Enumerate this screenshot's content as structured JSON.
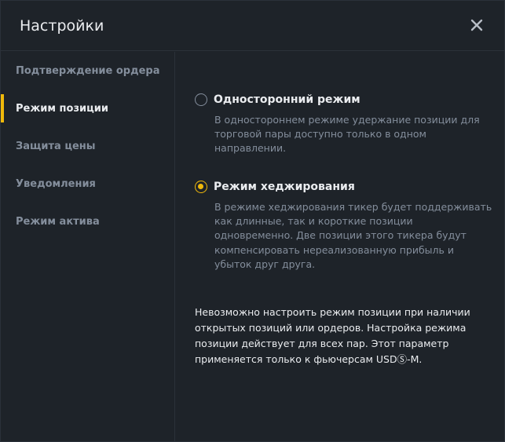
{
  "dialog": {
    "title": "Настройки"
  },
  "sidebar": {
    "items": [
      {
        "label": "Подтверждение ордера"
      },
      {
        "label": "Режим позиции"
      },
      {
        "label": "Защита цены"
      },
      {
        "label": "Уведомления"
      },
      {
        "label": "Режим актива"
      }
    ],
    "active": "Режим позиции"
  },
  "position_mode": {
    "options": [
      {
        "label": "Односторонний режим",
        "description": "В одностороннем режиме удержание позиции для торговой пары доступно только в одном направлении.",
        "selected": false
      },
      {
        "label": "Режим хеджирования",
        "description": "В режиме хеджирования тикер будет поддерживать как длинные, так и короткие позиции одновременно. Две позиции этого тикера будут компенсировать нереализованную прибыль и убыток друг друга.",
        "selected": true
      }
    ],
    "note": "Невозможно настроить режим позиции при наличии открытых позиций или ордеров. Настройка режима позиции действует для всех пар. Этот параметр применяется только к фьючерсам USDⓈ-M."
  },
  "colors": {
    "accent": "#f0b90b",
    "background": "#1e2329",
    "text_primary": "#eaecef",
    "text_secondary": "#848e9c"
  }
}
